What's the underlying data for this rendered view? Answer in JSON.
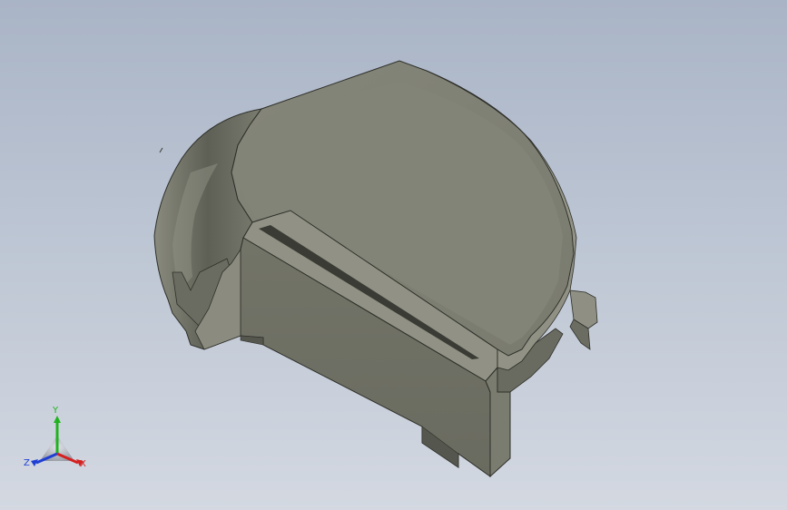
{
  "viewport": {
    "background_top": "#a9b4c6",
    "background_bottom": "#d3d8e1"
  },
  "model": {
    "body_color": "#7f8073",
    "face_color": "#6d6e62",
    "edge_color": "#2e2f29"
  },
  "triad": {
    "x_label": "X",
    "y_label": "Y",
    "z_label": "Z",
    "x_color": "#d42020",
    "y_color": "#1fb31f",
    "z_color": "#1f3fd4"
  }
}
